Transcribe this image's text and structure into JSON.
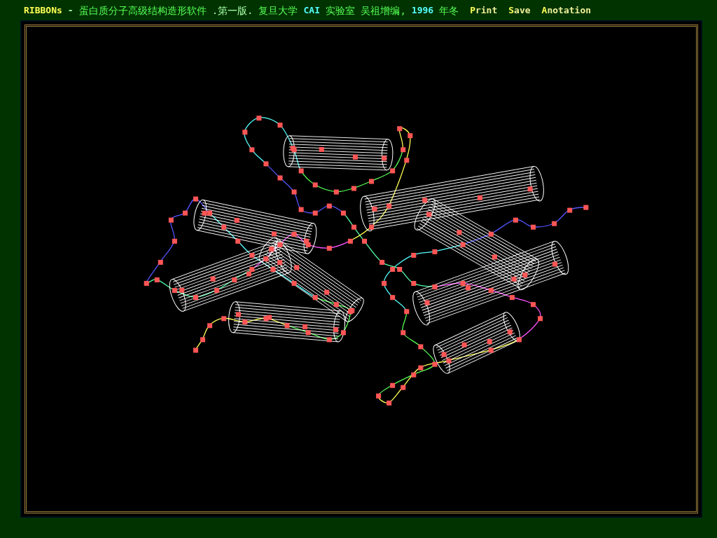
{
  "title_segments": [
    {
      "text": "RIBBONs",
      "color": "#ffff55"
    },
    {
      "text": "-",
      "color": "#aaffaa"
    },
    {
      "text": "蛋白质分子高级结构造形软件",
      "color": "#55ff55"
    },
    {
      "text": ".第一版.",
      "color": "#aaffaa"
    },
    {
      "text": "复旦大学",
      "color": "#55ff55"
    },
    {
      "text": "CAI",
      "color": "#55ffff"
    },
    {
      "text": "实验室 吴祖增编,",
      "color": "#55ff55"
    },
    {
      "text": "1996",
      "color": "#55ffff"
    },
    {
      "text": "年冬",
      "color": "#55ff55"
    }
  ],
  "menu": [
    {
      "label": "Print"
    },
    {
      "label": "Save"
    },
    {
      "label": "Anotation"
    }
  ]
}
